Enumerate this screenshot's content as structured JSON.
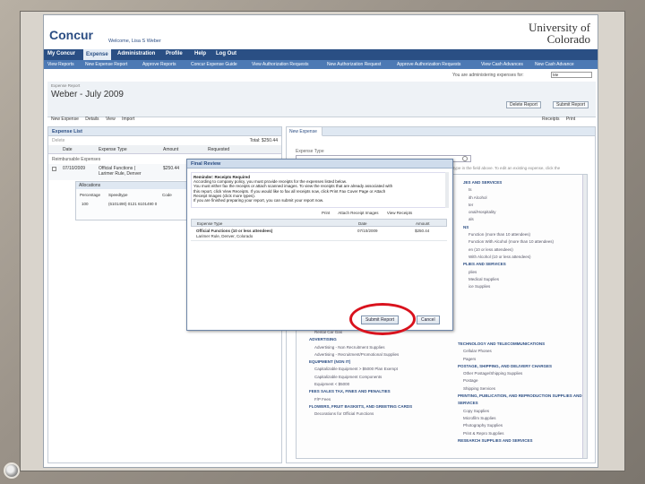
{
  "header": {
    "logo": "Concur",
    "welcome": "Welcome, Lisa S Weber",
    "university_line1": "University of",
    "university_line2": "Colorado"
  },
  "nav": [
    "My Concur",
    "Expense",
    "Administration",
    "Profile",
    "Help",
    "Log Out"
  ],
  "subnav": [
    "View Reports",
    "New Expense Report",
    "Approve Reports",
    "Concur Expense Guide",
    "View Authorization Requests",
    "New Authorization Request",
    "Approve Authorization Requests",
    "View Cash Advances",
    "New Cash Advance"
  ],
  "admin": {
    "label": "You are administering expenses for:",
    "value": "Me"
  },
  "report": {
    "label": "Expense Report",
    "title": "Weber - July 2009",
    "delete_btn": "Delete Report",
    "submit_btn": "Submit Report",
    "toolbar_new": "New Expense",
    "toolbar_details": "Details",
    "toolbar_view": "View",
    "toolbar_import": "Import",
    "toolbar_receipts": "Receipts",
    "toolbar_print": "Print"
  },
  "expense_list": {
    "title": "Expense List",
    "delete": "Delete",
    "total": "Total: $250.44",
    "columns": [
      "Date",
      "Expense Type",
      "Amount",
      "Requested"
    ],
    "group_label": "Reimbursable Expenses",
    "row": {
      "date": "07/10/2009",
      "type": "Official Functions (",
      "type2": "Larimer Rule, Denver",
      "amount": "$250.44"
    }
  },
  "allocations": {
    "title": "Allocations",
    "columns": [
      "Percentage",
      "Speedtype",
      "Code"
    ],
    "row": {
      "pct": "100",
      "speedtype": "(6101490) 0121 6101490 0"
    }
  },
  "new_expense": {
    "tab": "New Expense",
    "type_label": "Expense Type",
    "help": "To create a new expense, click the appropriate expense type below or type the expense type in the field above. To edit an existing expense, click the",
    "behind_label": "AIRLINE SERVICE FEES",
    "col_left": [
      {
        "t": "Rental Car Gas",
        "k": "item"
      },
      {
        "t": "ADVERTISING",
        "k": "cat"
      },
      {
        "t": "Advertising - Non Recruitment Supplies",
        "k": "item"
      },
      {
        "t": "Advertising - Recruitment/Promotional Supplies",
        "k": "item"
      },
      {
        "t": "EQUIPMENT (NON IT)",
        "k": "cat"
      },
      {
        "t": "Capitalizable Equipment > $5000 Plan Exempt",
        "k": "item"
      },
      {
        "t": "Capitalizable Equipment Components",
        "k": "item"
      },
      {
        "t": "Equipment < $5000",
        "k": "item"
      },
      {
        "t": "FEES SALES TAX, FINES AND PENALTIES",
        "k": "cat"
      },
      {
        "t": "F/P Fees",
        "k": "item"
      },
      {
        "t": "FLOWERS, FRUIT BASKETS, AND GREETING CARDS",
        "k": "cat"
      },
      {
        "t": "Decorations for Official Functions",
        "k": "item"
      }
    ],
    "col_right_top": [
      {
        "t": "JES AND SERVICES",
        "k": "cat"
      },
      {
        "t": "",
        "k": "item"
      },
      {
        "t": "ts",
        "k": "item"
      },
      {
        "t": "",
        "k": "item"
      },
      {
        "t": "ith Alcohol",
        "k": "item"
      },
      {
        "t": "ter",
        "k": "item"
      },
      {
        "t": "onal/Hospitality",
        "k": "item"
      },
      {
        "t": "als",
        "k": "item"
      },
      {
        "t": "NS",
        "k": "cat"
      },
      {
        "t": "Function (more than 10 attendees)",
        "k": "item"
      },
      {
        "t": "Function With Alcohol (more than 10 attendees)",
        "k": "item"
      },
      {
        "t": "en (10 or less attendees)",
        "k": "item"
      },
      {
        "t": "With Alcohol (10 or less attendees)",
        "k": "item"
      },
      {
        "t": "PLIES AND SERVICES",
        "k": "cat"
      },
      {
        "t": "plies",
        "k": "item"
      },
      {
        "t": "Medical Supplies",
        "k": "item"
      },
      {
        "t": "ice Supplies",
        "k": "item"
      }
    ],
    "col_right_bottom": [
      {
        "t": "TECHNOLOGY AND TELECOMMUNICATIONS",
        "k": "cat"
      },
      {
        "t": "Cellular Phones",
        "k": "item"
      },
      {
        "t": "Pagers",
        "k": "item"
      },
      {
        "t": "POSTAGE, SHIPPING, AND DELIVERY CHARGES",
        "k": "cat"
      },
      {
        "t": "Other Postage/Shipping Supplies",
        "k": "item"
      },
      {
        "t": "Postage",
        "k": "item"
      },
      {
        "t": "Shipping Services",
        "k": "item"
      },
      {
        "t": "PRINTING, PUBLICATION, AND REPRODUCTION SUPPLIES AND",
        "k": "cat"
      },
      {
        "t": "SERVICES",
        "k": "cat"
      },
      {
        "t": "Copy Supplies",
        "k": "item"
      },
      {
        "t": "Microfilm Supplies",
        "k": "item"
      },
      {
        "t": "Photography Supplies",
        "k": "item"
      },
      {
        "t": "Print & Repro Supplies",
        "k": "item"
      },
      {
        "t": "RESEARCH SUPPLIES AND SERVICES",
        "k": "cat"
      }
    ]
  },
  "modal": {
    "title": "Final Review",
    "heading": "Reminder: Receipts Required",
    "line1": "According to company policy, you must provide receipts for the expenses listed below.",
    "line2": "You must either fax the receipts or attach scanned images. To view the receipts that are already associated with",
    "line3": "this report, click View Receipts. If you would like to fax all receipts now, click Print Fax Cover Page or Attach",
    "line4": "Receipt Images (click more types).",
    "line5": "If you are finished preparing your report, you can submit your report now.",
    "tool_print": "Print",
    "tool_attach": "Attach Receipt Images",
    "tool_view": "View Receipts",
    "columns": [
      "Expense Type",
      "Date",
      "Amount"
    ],
    "row": {
      "type": "Official Functions (10 or less attendees)",
      "location": "Larimer Rule, Denver, Colorado",
      "date": "07/10/2009",
      "amount": "$250.44"
    },
    "submit": "Submit Report",
    "cancel": "Cancel"
  }
}
